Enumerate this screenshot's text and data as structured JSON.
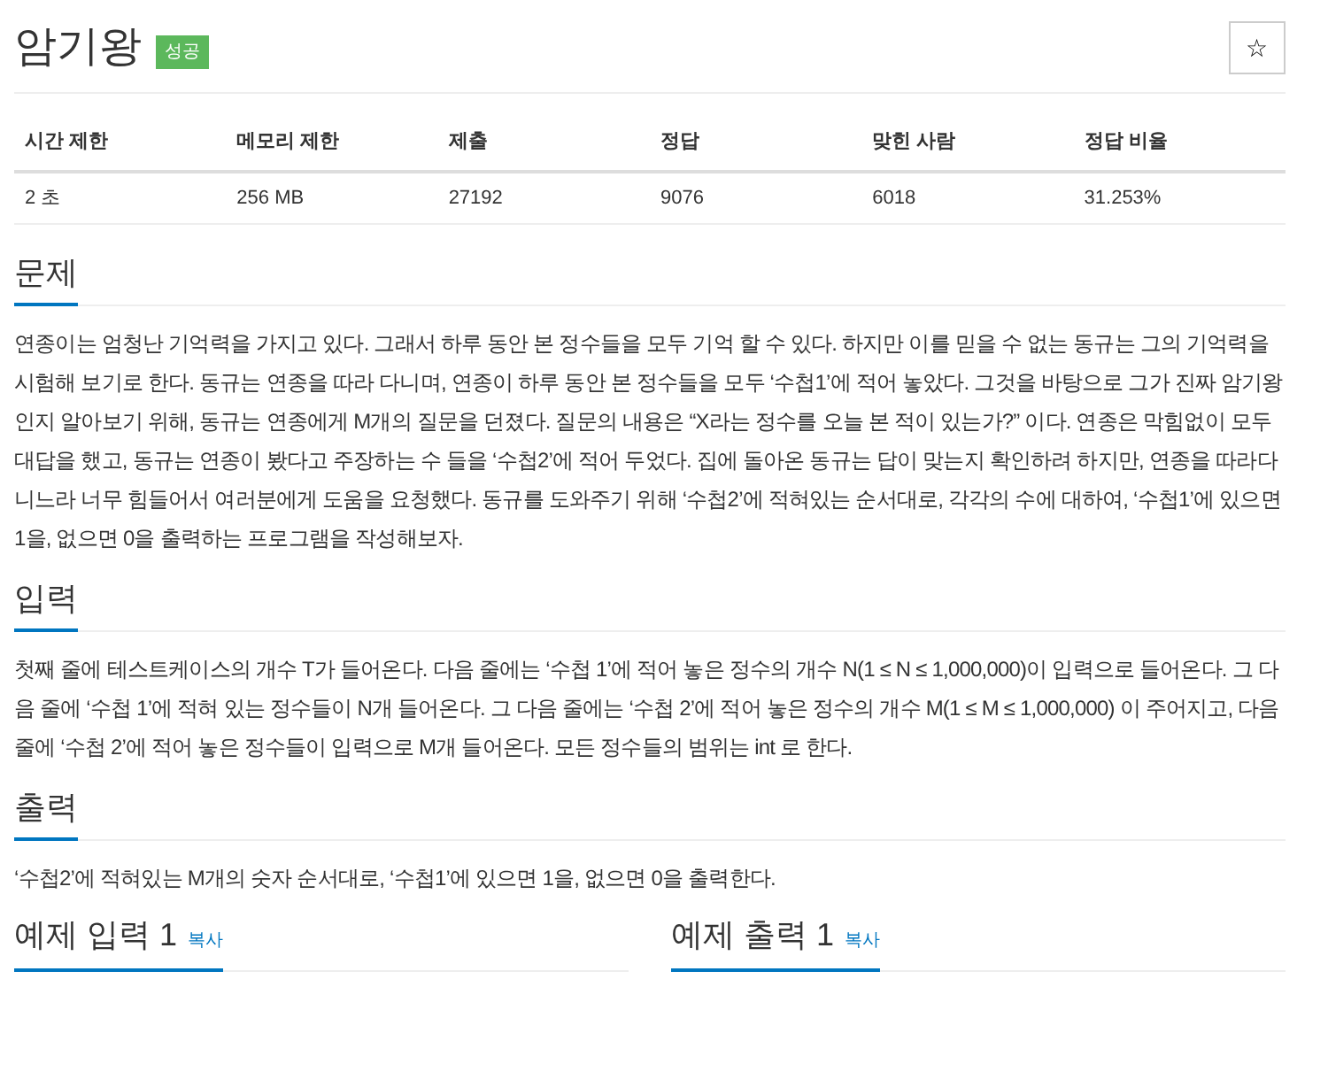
{
  "problem": {
    "title": "암기왕",
    "badge": "성공",
    "starred": false,
    "star": "☆"
  },
  "limits_table": {
    "columns": [
      "시간 제한",
      "메모리 제한",
      "제출",
      "정답",
      "맞힌 사람",
      "정답 비율"
    ],
    "rows": [
      [
        "2 초",
        "256 MB",
        "27192",
        "9076",
        "6018",
        "31.253%"
      ]
    ]
  },
  "sections": [
    {
      "heading": "문제",
      "body": "연종이는 엄청난 기억력을 가지고 있다. 그래서 하루 동안 본 정수들을 모두 기억 할 수 있다. 하지만 이를 믿을 수 없는 동규는 그의 기억력을 시험해 보기로 한다. 동규는 연종을 따라 다니며, 연종이 하루 동안 본 정수들을 모두 ‘수첩1’에 적어 놓았다. 그것을 바탕으로 그가 진짜 암기왕인지 알아보기 위해, 동규는 연종에게 M개의 질문을 던졌다. 질문의 내용은 “X라는 정수를 오늘 본 적이 있는가?” 이다. 연종은 막힘없이 모두 대답을 했고, 동규는 연종이 봤다고 주장하는 수 들을 ‘수첩2’에 적어 두었다. 집에 돌아온 동규는 답이 맞는지 확인하려 하지만, 연종을 따라다니느라 너무 힘들어서 여러분에게 도움을 요청했다. 동규를 도와주기 위해 ‘수첩2’에 적혀있는 순서대로, 각각의 수에 대하여, ‘수첩1’에 있으면 1을, 없으면 0을 출력하는 프로그램을 작성해보자."
    },
    {
      "heading": "입력",
      "body": "첫째 줄에 테스트케이스의 개수 T가 들어온다. 다음 줄에는 ‘수첩 1’에 적어 놓은 정수의 개수 N(1 ≤ N ≤ 1,000,000)이 입력으로 들어온다. 그 다음 줄에  ‘수첩 1’에 적혀 있는 정수들이 N개 들어온다. 그 다음 줄에는 ‘수첩 2’에 적어 놓은 정수의 개수 M(1 ≤ M ≤ 1,000,000) 이 주어지고, 다음 줄에 ‘수첩 2’에 적어 놓은 정수들이 입력으로 M개 들어온다. 모든 정수들의 범위는 int 로 한다."
    },
    {
      "heading": "출력",
      "body": "‘수첩2’에 적혀있는 M개의 숫자 순서대로, ‘수첩1’에 있으면 1을, 없으면 0을 출력한다."
    }
  ],
  "examples": [
    {
      "heading": "예제 입력 1",
      "copy": "복사"
    },
    {
      "heading": "예제 출력 1",
      "copy": "복사"
    }
  ]
}
